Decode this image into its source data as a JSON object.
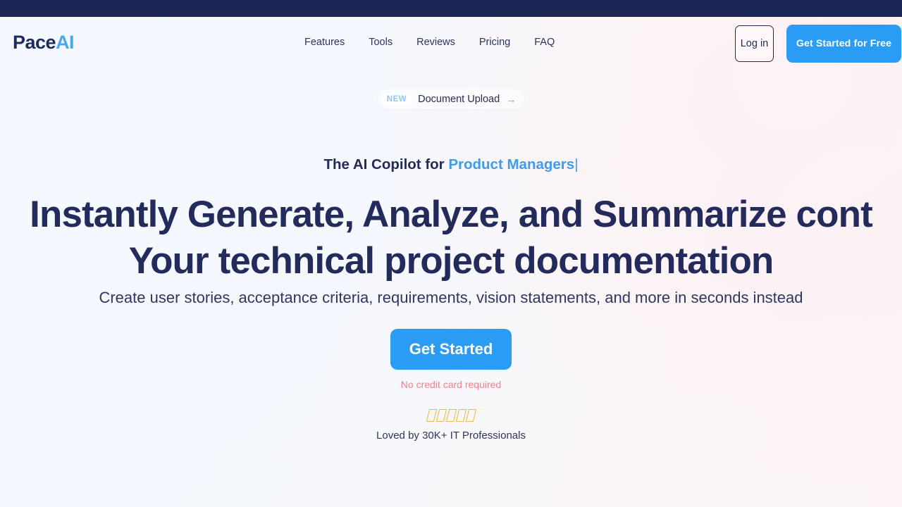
{
  "brand": {
    "name_primary": "Pace",
    "name_accent": "AI",
    "accent_color": "#49a7ec",
    "navy_color": "#1d2a5e"
  },
  "topbar": {
    "color": "#1b2655"
  },
  "nav": {
    "items": [
      {
        "label": "Features"
      },
      {
        "label": "Tools"
      },
      {
        "label": "Reviews"
      },
      {
        "label": "Pricing"
      },
      {
        "label": "FAQ"
      }
    ]
  },
  "auth": {
    "login_label": "Log in",
    "cta_label": "Get Started for Free",
    "cta_color": "#2b9cf5"
  },
  "announcement": {
    "badge": "NEW",
    "text": "Document Upload",
    "arrow_icon": "→",
    "badge_color": "#8fc7f2"
  },
  "hero": {
    "eyebrow_static": "The AI Copilot for ",
    "eyebrow_typed": "Product Managers",
    "eyebrow_caret": "|",
    "headline_line1": "Instantly Generate, Analyze, and Summarize cont",
    "headline_line2": "Your technical project documentation",
    "subtitle": "Create user stories, acceptance criteria, requirements, vision statements, and more in seconds instead"
  },
  "cta": {
    "button_label": "Get Started",
    "note": "No credit card required",
    "note_color": "#f4818a"
  },
  "social_proof": {
    "star_count": 5,
    "star_color": "#f0b441",
    "text": "Loved by 30K+ IT Professionals"
  }
}
